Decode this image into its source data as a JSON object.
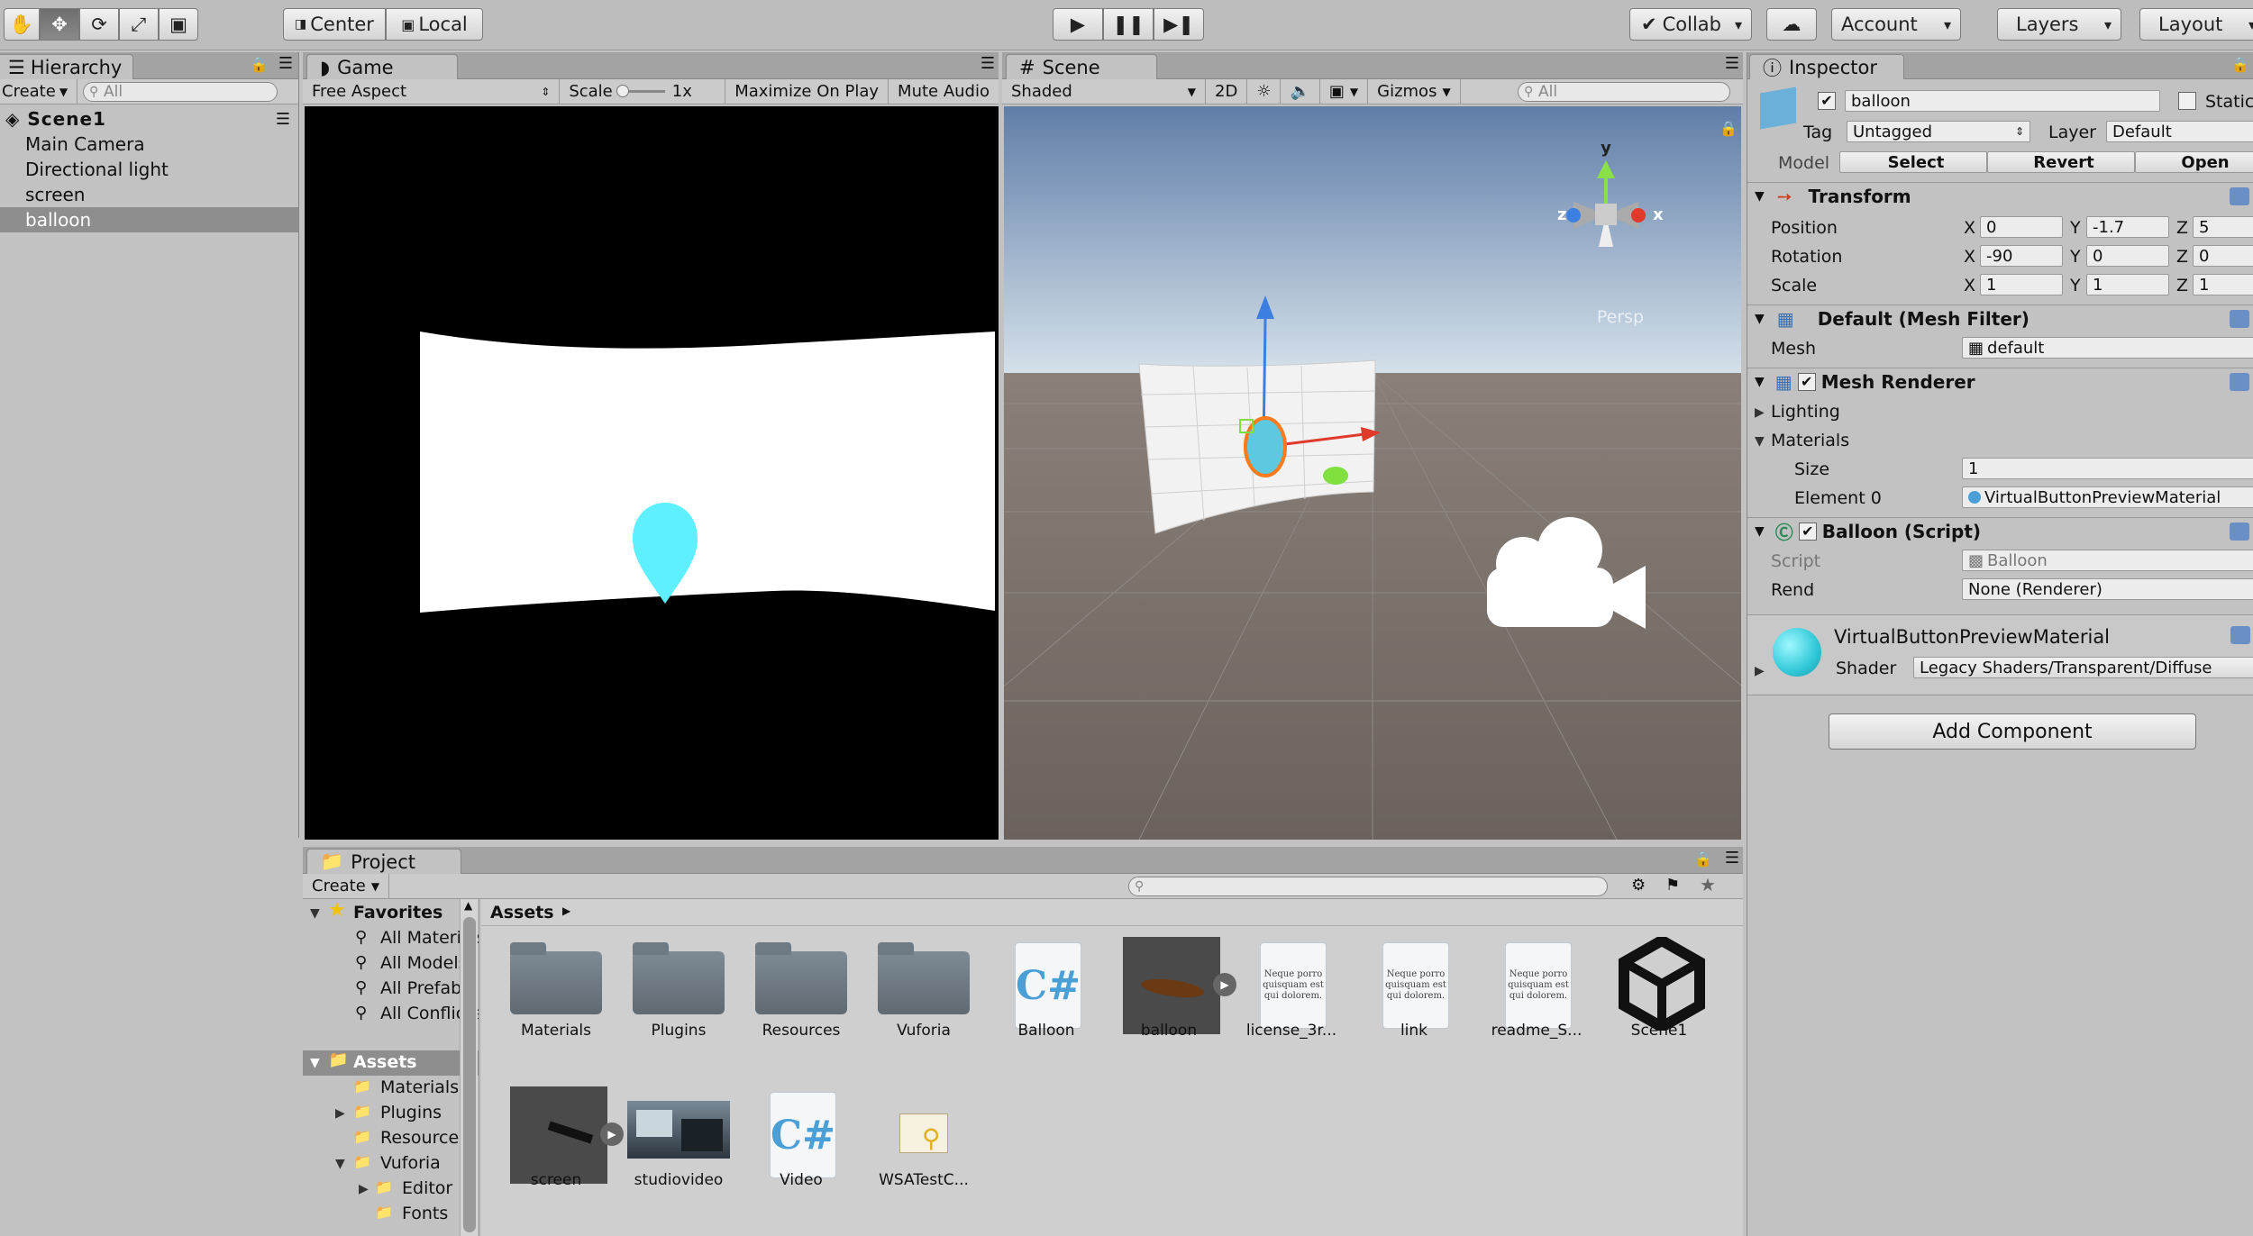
{
  "toolbar": {
    "pivot_label": "Center",
    "space_label": "Local",
    "collab_label": "Collab",
    "account_label": "Account",
    "layers_label": "Layers",
    "layout_label": "Layout"
  },
  "hierarchy": {
    "tab_label": "Hierarchy",
    "create_label": "Create",
    "search_placeholder": "All",
    "scene_name": "Scene1",
    "items": [
      "Main Camera",
      "Directional light",
      "screen",
      "balloon"
    ],
    "selected": "balloon"
  },
  "game": {
    "tab_label": "Game",
    "aspect_label": "Free Aspect",
    "scale_label": "Scale",
    "scale_value": "1x",
    "maximize_label": "Maximize On Play",
    "mute_label": "Mute Audio"
  },
  "scene": {
    "tab_label": "Scene",
    "shading_label": "Shaded",
    "mode_2d_label": "2D",
    "gizmos_label": "Gizmos",
    "search_placeholder": "All",
    "persp_label": "Persp",
    "axis_labels": {
      "x": "x",
      "y": "y",
      "z": "z"
    }
  },
  "inspector": {
    "tab_label": "Inspector",
    "object_name": "balloon",
    "static_label": "Static",
    "tag_label": "Tag",
    "tag_value": "Untagged",
    "layer_label": "Layer",
    "layer_value": "Default",
    "model_label": "Model",
    "model_buttons": [
      "Select",
      "Revert",
      "Open"
    ],
    "transform": {
      "title": "Transform",
      "rows": [
        {
          "label": "Position",
          "x": "0",
          "y": "-1.7",
          "z": "5"
        },
        {
          "label": "Rotation",
          "x": "-90",
          "y": "0",
          "z": "0"
        },
        {
          "label": "Scale",
          "x": "1",
          "y": "1",
          "z": "1"
        }
      ],
      "axis_x": "X",
      "axis_y": "Y",
      "axis_z": "Z"
    },
    "mesh_filter": {
      "title": "Default (Mesh Filter)",
      "mesh_label": "Mesh",
      "mesh_value": "default"
    },
    "mesh_renderer": {
      "title": "Mesh Renderer",
      "lighting_label": "Lighting",
      "materials_label": "Materials",
      "size_label": "Size",
      "size_value": "1",
      "element_label": "Element 0",
      "element_value": "VirtualButtonPreviewMaterial"
    },
    "balloon_script": {
      "title": "Balloon (Script)",
      "script_label": "Script",
      "script_value": "Balloon",
      "rend_label": "Rend",
      "rend_value": "None (Renderer)"
    },
    "material": {
      "name": "VirtualButtonPreviewMaterial",
      "shader_label": "Shader",
      "shader_value": "Legacy Shaders/Transparent/Diffuse"
    },
    "add_component_label": "Add Component"
  },
  "project": {
    "tab_label": "Project",
    "create_label": "Create",
    "favorites_label": "Favorites",
    "favorites": [
      "All Materials",
      "All Models",
      "All Prefabs",
      "All Conflicted"
    ],
    "assets_label": "Assets",
    "tree": [
      "Materials",
      "Plugins",
      "Resources",
      "Vuforia",
      "Editor",
      "Fonts"
    ],
    "breadcrumb": "Assets",
    "assets": [
      {
        "name": "Materials",
        "kind": "folder"
      },
      {
        "name": "Plugins",
        "kind": "folder"
      },
      {
        "name": "Resources",
        "kind": "folder"
      },
      {
        "name": "Vuforia",
        "kind": "folder"
      },
      {
        "name": "Balloon",
        "kind": "script"
      },
      {
        "name": "balloon",
        "kind": "model"
      },
      {
        "name": "license_3r...",
        "kind": "text"
      },
      {
        "name": "link",
        "kind": "text"
      },
      {
        "name": "readme_S...",
        "kind": "text"
      },
      {
        "name": "Scene1",
        "kind": "unity"
      },
      {
        "name": "screen",
        "kind": "model"
      },
      {
        "name": "studiovideo",
        "kind": "video"
      },
      {
        "name": "Video",
        "kind": "script"
      },
      {
        "name": "WSATestC...",
        "kind": "cert"
      }
    ],
    "text_preview": "Neque porro quisquam est qui dolorem."
  },
  "colors": {
    "accent": "#5ef0ff",
    "selection": "#8e8e8e",
    "panel": "#c2c2c2"
  }
}
